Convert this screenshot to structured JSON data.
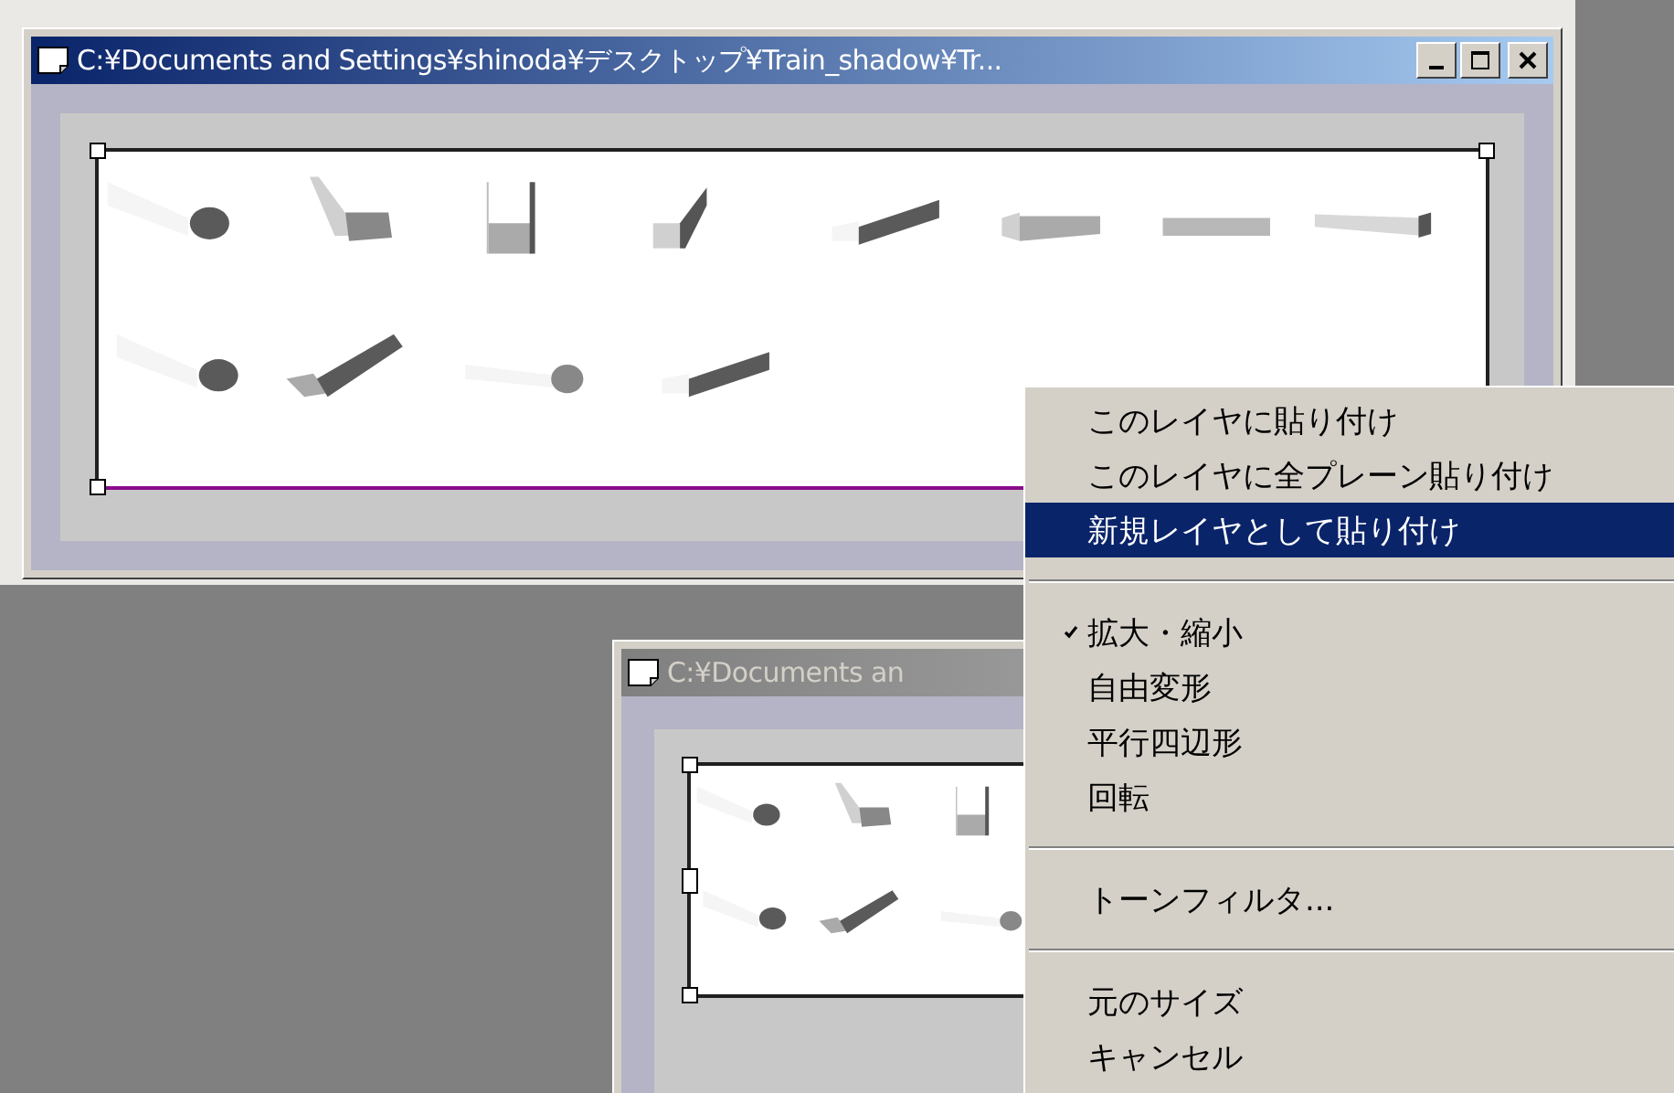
{
  "windows": [
    {
      "title": "C:¥Documents and Settings¥shinoda¥デスクトップ¥Train_shadow¥Tr...",
      "active": true
    },
    {
      "title": "C:¥Documents an",
      "active": false
    }
  ],
  "context_menu": {
    "items": [
      {
        "kind": "item",
        "label": "このレイヤに貼り付け",
        "checked": false,
        "selected": false
      },
      {
        "kind": "item",
        "label": "このレイヤに全プレーン貼り付け",
        "checked": false,
        "selected": false
      },
      {
        "kind": "item",
        "label": "新規レイヤとして貼り付け",
        "checked": false,
        "selected": true
      },
      {
        "kind": "separator"
      },
      {
        "kind": "item",
        "label": "拡大・縮小",
        "checked": true,
        "selected": false
      },
      {
        "kind": "item",
        "label": "自由変形",
        "checked": false,
        "selected": false
      },
      {
        "kind": "item",
        "label": "平行四辺形",
        "checked": false,
        "selected": false
      },
      {
        "kind": "item",
        "label": "回転",
        "checked": false,
        "selected": false
      },
      {
        "kind": "separator"
      },
      {
        "kind": "item",
        "label": "トーンフィルタ...",
        "checked": false,
        "selected": false
      },
      {
        "kind": "separator"
      },
      {
        "kind": "item",
        "label": "元のサイズ",
        "checked": false,
        "selected": false
      },
      {
        "kind": "item",
        "label": "キャンセル",
        "checked": false,
        "selected": false
      }
    ]
  }
}
